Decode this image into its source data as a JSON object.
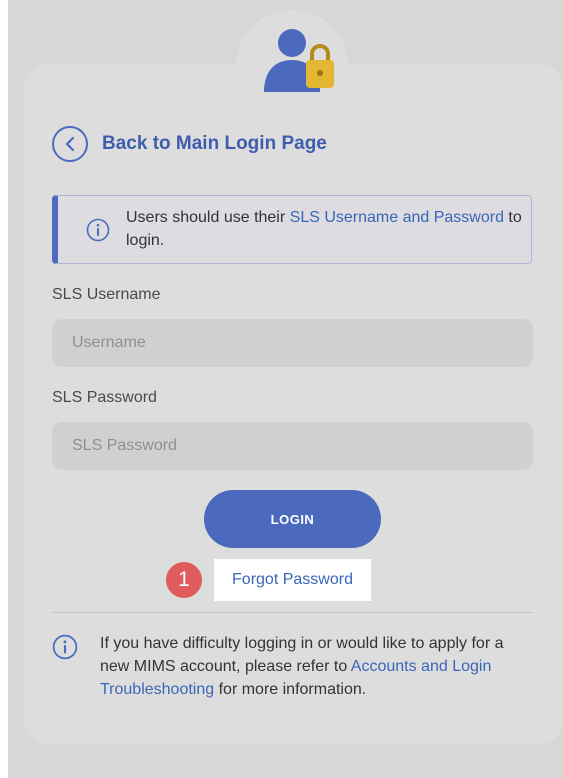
{
  "back_link": {
    "label": "Back to Main Login Page"
  },
  "notice": {
    "prefix": "Users should use their ",
    "link": "SLS Username and Password",
    "suffix": " to login."
  },
  "username": {
    "label": "SLS Username",
    "placeholder": "Username",
    "value": ""
  },
  "password": {
    "label": "SLS Password",
    "placeholder": "SLS Password",
    "value": ""
  },
  "login_button": {
    "label": "LOGIN"
  },
  "forgot": {
    "badge": "1",
    "label": "Forgot Password"
  },
  "help": {
    "prefix": "If you have difficulty logging in or would like to apply for a new MIMS account, please refer to ",
    "link": "Accounts and Login Troubleshooting",
    "suffix": " for more information."
  },
  "colors": {
    "accent": "#4b69bd",
    "link": "#3a66b8",
    "badge": "#e05b5b",
    "lock": "#e3b731"
  },
  "icons": [
    "user-lock-icon",
    "chevron-left-icon",
    "info-icon"
  ]
}
